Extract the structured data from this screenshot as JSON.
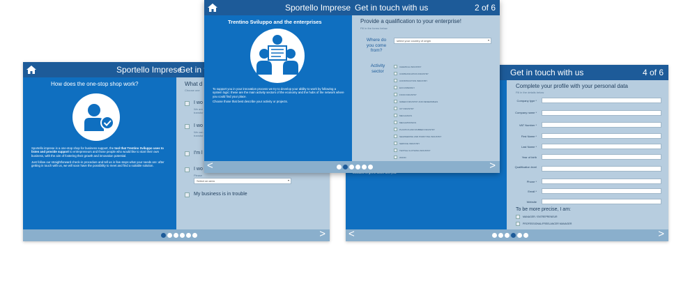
{
  "common": {
    "app_title": "Sportello Imprese",
    "subtitle": "Get in touch with us",
    "prev_arrow": "<",
    "next_arrow": ">"
  },
  "left": {
    "heading": "How does the one-stop shop work?",
    "intro_a": "Sportello imprese is a one-stop shop for business support, the",
    "intro_bold": "tool that Trentino Sviluppo uses to listen and provide support",
    "intro_b": "to entrepreneurs and those people who would like to start their own business, with the aim of fostering their growth and innovation potential.",
    "intro_2": "Just follow our straightforward check-in procedure and tell us in few steps what your needs are: after getting in touch with us, we will soon have the possibility to meet and find a suitable solution.",
    "right_heading": "What d",
    "right_sub": "Choose one",
    "options": [
      "I wo",
      "I wo",
      "I'm l",
      "I wo"
    ],
    "opt_sub_1": "We are\ntransfor",
    "opt_sub_2": "We can\ntransfor",
    "opt_sub_4": "Please",
    "select_placeholder": "Select an area",
    "last_option": "My business is in trouble",
    "page_dots": 6,
    "active_dot": 0
  },
  "middle": {
    "page": "2 of 6",
    "left_heading": "Trentino Sviluppo and the enterprises",
    "left_text_1": "To support you in your innovation process we try to develop your ability to work by following a system logic: these are the main activity sectors of the economy and the hubs of the network where you could find your place.",
    "left_text_2": "Choose those that best describe your activity or projects.",
    "right_heading": "Provide a qualification to your enterprise!",
    "right_sub": "Fill in the forms below",
    "where_label": "Where do you come from?",
    "select_placeholder": "select your country of origin",
    "sector_label": "Activity sector",
    "sectors": [
      "CHEMICAL INDUSTRY",
      "COMMUNICATION INDUSTRY",
      "CONSTRUCTION INDUSTRY",
      "ECO-FRIENDLY",
      "FOOD INDUSTRY",
      "GREEN INDUSTRY AND RENEWABLES",
      "ICT INDUSTRY",
      "MECHANICS",
      "MECHATRONICS",
      "PLASTICS AND RUBBER INDUSTRY",
      "SEAWEEDING AND PURIFYING INDUSTRY",
      "SERVICE INDUSTRY",
      "TEXTILE CLOTHING INDUSTRY",
      "WOOD"
    ],
    "page_dots": 6,
    "active_dot": 1
  },
  "right": {
    "page": "4 of 6",
    "heading": "Complete your profile with your personal data",
    "sub": "Fill in the details below",
    "fields": [
      "Company type *",
      "Company name *",
      "VAT Number *",
      "First Name *",
      "Last Name *",
      "Year of birth",
      "Qualification level",
      "Phone *",
      "Email *",
      "Website"
    ],
    "precise_heading": "To be more precise, I am:",
    "precise_options": [
      "MANAGER / ENTREPRENEUR",
      "PROFESSIONAL/FREELANCER MANAGER"
    ],
    "left_fragment": "available to get in touch with you.",
    "page_dots": 6,
    "active_dot": 3
  },
  "colors": {
    "brand_blue": "#0f6fc0",
    "bar_dark": "#1d5b99",
    "bar_light": "#8aafcc",
    "form_bg": "#b7cddf"
  }
}
